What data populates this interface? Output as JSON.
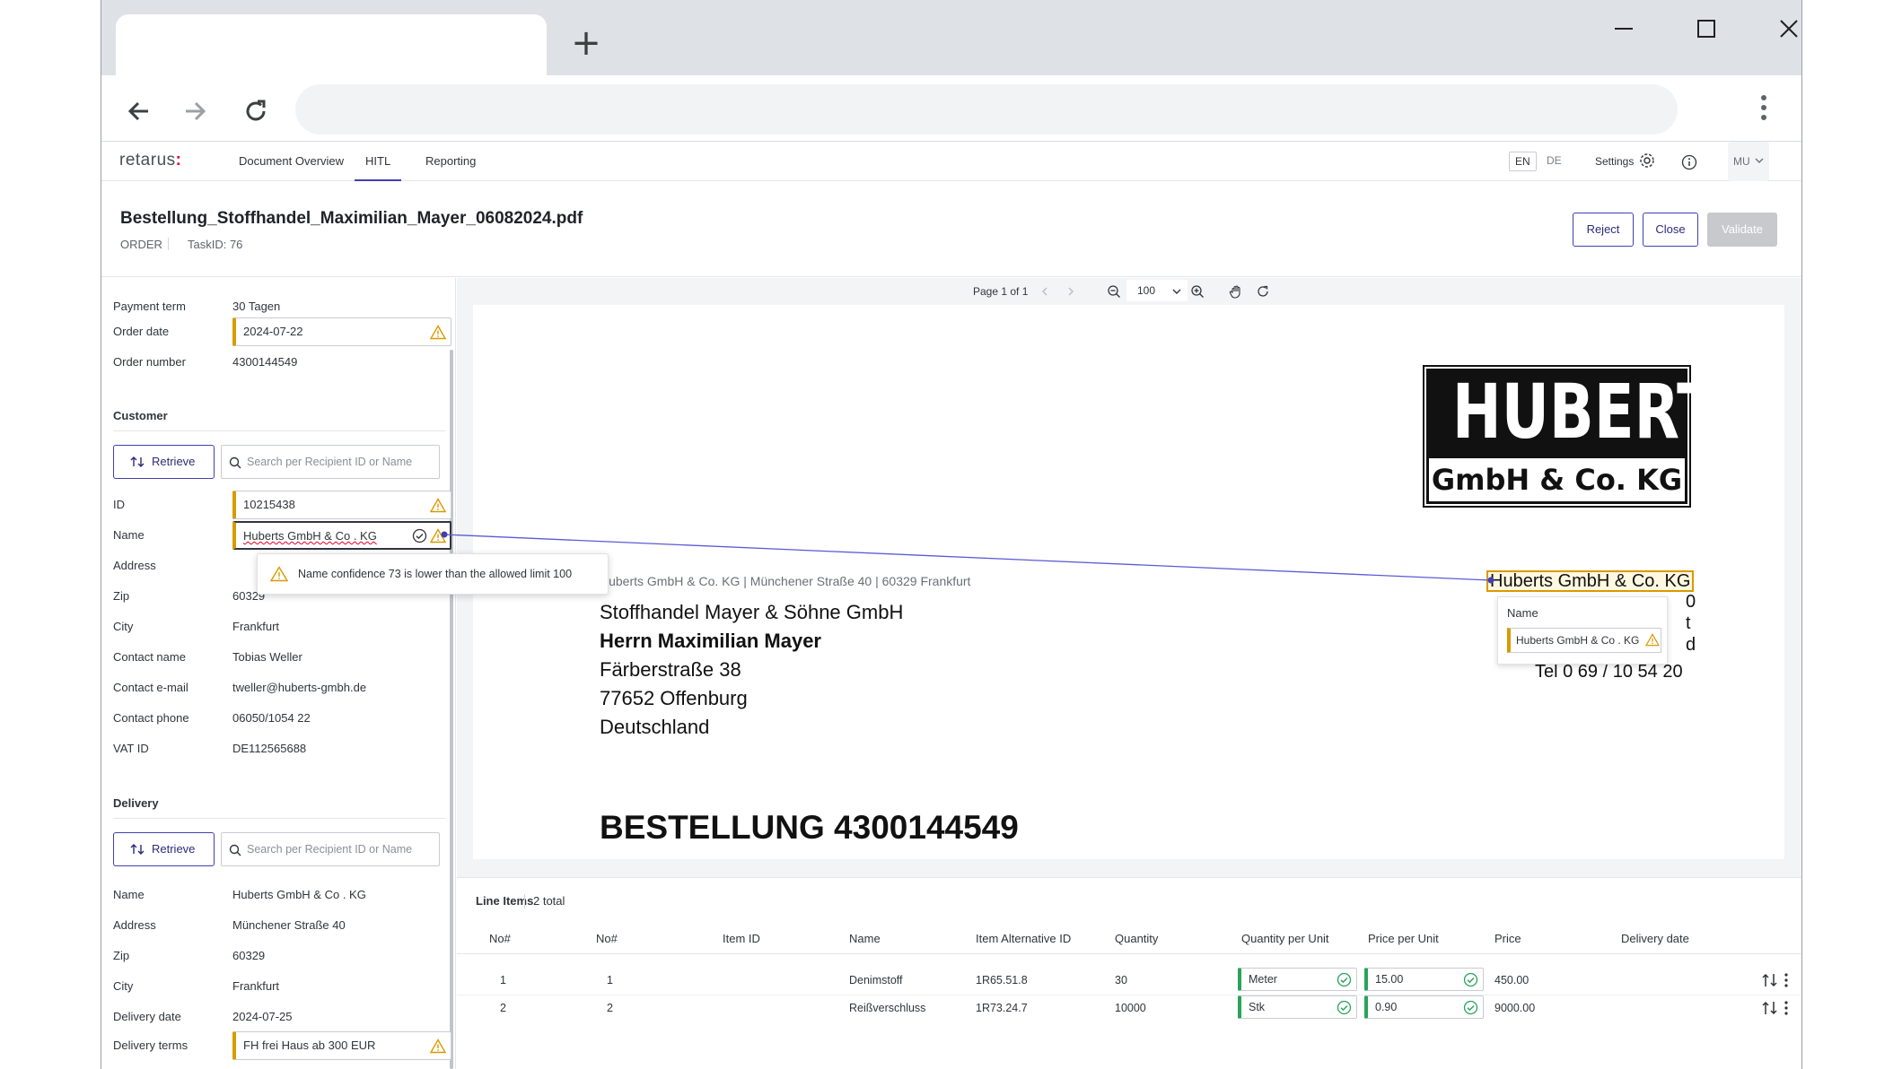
{
  "browser": {
    "new_tab_glyph": "+",
    "minimize_glyph": "—",
    "maximize_glyph": "☐",
    "close_glyph": "✕"
  },
  "app": {
    "logo_text": "retarus",
    "logo_mark": ":",
    "nav": [
      "Document Overview",
      "HITL",
      "Reporting"
    ],
    "active_nav": "HITL",
    "lang": [
      "EN",
      "DE"
    ],
    "settings_label": "Settings",
    "user_initials": "MU"
  },
  "document": {
    "title": "Bestellung_Stoffhandel_Maximilian_Mayer_06082024.pdf",
    "type": "ORDER",
    "task_id": "TaskID: 76",
    "buttons": {
      "reject": "Reject",
      "close": "Close",
      "validate": "Validate"
    }
  },
  "fields_top": [
    {
      "label": "Payment term",
      "value": "30 Tagen"
    },
    {
      "label": "Order date",
      "value": "2024-07-22"
    },
    {
      "label": "Order number",
      "value": "4300144549"
    }
  ],
  "customer": {
    "heading": "Customer",
    "retrieve_label": "Retrieve",
    "search_placeholder": "Search per Recipient ID or Name",
    "id_label": "ID",
    "id_value": "10215438",
    "name_label": "Name",
    "name_value": "Huberts GmbH & Co . KG",
    "address_label": "Address",
    "zip_label": "Zip",
    "zip_value": "60329",
    "city_label": "City",
    "city_value": "Frankfurt",
    "contact_name_label": "Contact name",
    "contact_name_value": "Tobias Weller",
    "contact_email_label": "Contact e-mail",
    "contact_email_value": "tweller@huberts-gmbh.de",
    "contact_phone_label": "Contact phone",
    "contact_phone_value": "06050/1054 22",
    "vat_label": "VAT ID",
    "vat_value": "DE112565688",
    "tooltip": "Name confidence 73 is lower than the allowed limit 100"
  },
  "delivery": {
    "heading": "Delivery",
    "retrieve_label": "Retrieve",
    "search_placeholder": "Search per Recipient ID or Name",
    "name_label": "Name",
    "name_value": "Huberts GmbH & Co . KG",
    "address_label": "Address",
    "address_value": "Münchener Straße 40",
    "zip_label": "Zip",
    "zip_value": "60329",
    "city_label": "City",
    "city_value": "Frankfurt",
    "date_label": "Delivery date",
    "date_value": "2024-07-25",
    "terms_label": "Delivery terms",
    "terms_value": "FH frei Haus ab 300 EUR"
  },
  "viewer": {
    "page_info": "Page 1 of 1",
    "zoom": "100"
  },
  "pdf": {
    "logo_line1": "HUBERTS",
    "logo_line2": "GmbH & Co. KG",
    "sender_line": "Huberts GmbH & Co. KG | Münchener Straße 40 | 60329 Frankfurt",
    "recipient": [
      "Stoffhandel Mayer & Söhne GmbH",
      "Herrn Maximilian Mayer",
      "Färberstraße 38",
      "77652 Offenburg",
      "Deutschland"
    ],
    "company_right": "Huberts GmbH & Co. KG",
    "tel": "Tel  0 69 / 10 54 20",
    "right_fragments": [
      "0",
      "t",
      "d"
    ],
    "heading": "BESTELLUNG 4300144549",
    "popup_label": "Name",
    "popup_value": "Huberts GmbH & Co . KG"
  },
  "line_items": {
    "title": "Line Items",
    "total": "2 total",
    "columns": [
      "No#",
      "No#",
      "Item ID",
      "Name",
      "Item Alternative ID",
      "Quantity",
      "Quantity per Unit",
      "Price per Unit",
      "Price",
      "Delivery date"
    ],
    "rows": [
      {
        "no1": "1",
        "no2": "1",
        "item_id": "",
        "name": "Denimstoff",
        "alt_id": "1R65.51.8",
        "qty": "30",
        "unit": "Meter",
        "ppu": "15.00",
        "price": "450.00",
        "date": ""
      },
      {
        "no1": "2",
        "no2": "2",
        "item_id": "",
        "name": "Reißverschluss",
        "alt_id": "1R73.24.7",
        "qty": "10000",
        "unit": "Stk",
        "ppu": "0.90",
        "price": "9000.00",
        "date": ""
      }
    ]
  }
}
